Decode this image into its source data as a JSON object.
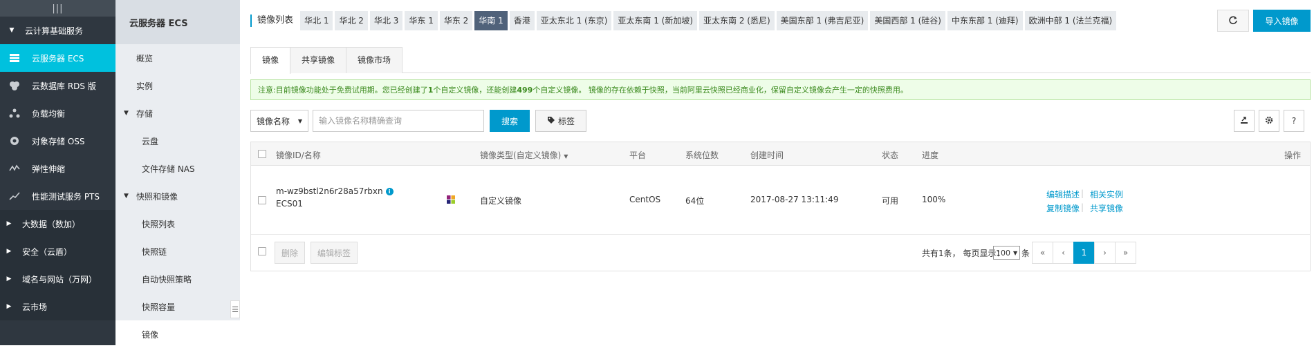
{
  "leftnav": {
    "collapse_icon": "menu-collapse-icon",
    "group_label": "云计算基础服务",
    "items": [
      {
        "label": "云服务器 ECS",
        "icon": "server-icon"
      },
      {
        "label": "云数据库 RDS 版",
        "icon": "database-icon"
      },
      {
        "label": "负载均衡",
        "icon": "load-balancer-icon"
      },
      {
        "label": "对象存储 OSS",
        "icon": "cloud-storage-icon"
      },
      {
        "label": "弹性伸缩",
        "icon": "autoscale-icon"
      },
      {
        "label": "性能测试服务 PTS",
        "icon": "trend-chart-icon"
      }
    ],
    "sections": [
      "大数据（数加）",
      "安全（云盾）",
      "域名与网站（万网）",
      "云市场"
    ]
  },
  "subnav": {
    "title": "云服务器 ECS",
    "items": {
      "overview": "概览",
      "instances": "实例",
      "storage_group": "存储",
      "disk": "云盘",
      "nas": "文件存储 NAS",
      "snap_group": "快照和镜像",
      "snap_list": "快照列表",
      "snap_chain": "快照链",
      "auto_policy": "自动快照策略",
      "snap_capacity": "快照容量",
      "images": "镜像"
    }
  },
  "header": {
    "title": "镜像列表",
    "regions": [
      "华北 1",
      "华北 2",
      "华北 3",
      "华东 1",
      "华东 2",
      "华南 1",
      "香港",
      "亚太东北 1 (东京)",
      "亚太东南 1 (新加坡)",
      "亚太东南 2 (悉尼)",
      "美国东部 1 (弗吉尼亚)",
      "美国西部 1 (硅谷)",
      "中东东部 1 (迪拜)",
      "欧洲中部 1 (法兰克福)"
    ],
    "active_region": "华南 1",
    "import_label": "导入镜像"
  },
  "tabs": [
    "镜像",
    "共享镜像",
    "镜像市场"
  ],
  "notice": {
    "part1": "注意:目前镜像功能处于免费试用期。您已经创建了",
    "count_created": "1",
    "part2": "个自定义镜像，还能创建",
    "count_left": "499",
    "part3": "个自定义镜像。 镜像的存在依赖于快照，当前阿里云快照已经商业化，保留自定义镜像会产生一定的快照费用。"
  },
  "search": {
    "select_value": "镜像名称",
    "placeholder": "输入镜像名称精确查询",
    "search_label": "搜索",
    "tag_label": "标签"
  },
  "table": {
    "headers": {
      "id": "镜像ID/名称",
      "type": "镜像类型(自定义镜像)",
      "platform": "平台",
      "bits": "系统位数",
      "created": "创建时间",
      "status": "状态",
      "progress": "进度",
      "ops": "操作"
    },
    "rows": [
      {
        "id": "m-wz9bstl2n6r28a57rbxn",
        "name": "ECS01",
        "type": "自定义镜像",
        "platform": "CentOS",
        "bits": "64位",
        "created": "2017-08-27 13:11:49",
        "status": "可用",
        "progress": "100%",
        "ops": {
          "edit_desc": "编辑描述",
          "related": "相关实例",
          "copy": "复制镜像",
          "share": "共享镜像"
        }
      }
    ],
    "footer": {
      "delete": "删除",
      "edit_tags": "编辑标签",
      "summary": "共有1条， 每页显示：",
      "page_size": "100",
      "unit": "条",
      "pages": [
        "«",
        "‹",
        "1",
        "›",
        "»"
      ],
      "current_page": "1"
    }
  }
}
